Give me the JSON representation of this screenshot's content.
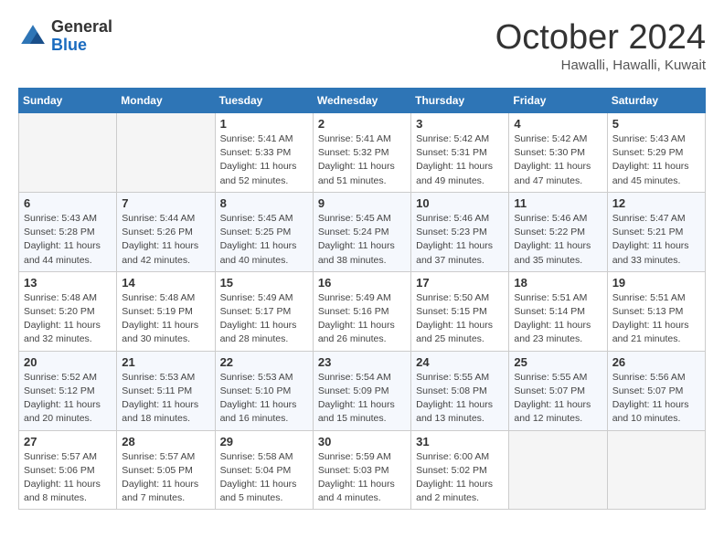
{
  "header": {
    "logo": {
      "general": "General",
      "blue": "Blue"
    },
    "title": "October 2024",
    "location": "Hawalli, Hawalli, Kuwait"
  },
  "weekdays": [
    "Sunday",
    "Monday",
    "Tuesday",
    "Wednesday",
    "Thursday",
    "Friday",
    "Saturday"
  ],
  "weeks": [
    [
      {
        "day": "",
        "empty": true
      },
      {
        "day": "",
        "empty": true
      },
      {
        "day": "1",
        "sunrise": "5:41 AM",
        "sunset": "5:33 PM",
        "daylight": "11 hours and 52 minutes."
      },
      {
        "day": "2",
        "sunrise": "5:41 AM",
        "sunset": "5:32 PM",
        "daylight": "11 hours and 51 minutes."
      },
      {
        "day": "3",
        "sunrise": "5:42 AM",
        "sunset": "5:31 PM",
        "daylight": "11 hours and 49 minutes."
      },
      {
        "day": "4",
        "sunrise": "5:42 AM",
        "sunset": "5:30 PM",
        "daylight": "11 hours and 47 minutes."
      },
      {
        "day": "5",
        "sunrise": "5:43 AM",
        "sunset": "5:29 PM",
        "daylight": "11 hours and 45 minutes."
      }
    ],
    [
      {
        "day": "6",
        "sunrise": "5:43 AM",
        "sunset": "5:28 PM",
        "daylight": "11 hours and 44 minutes."
      },
      {
        "day": "7",
        "sunrise": "5:44 AM",
        "sunset": "5:26 PM",
        "daylight": "11 hours and 42 minutes."
      },
      {
        "day": "8",
        "sunrise": "5:45 AM",
        "sunset": "5:25 PM",
        "daylight": "11 hours and 40 minutes."
      },
      {
        "day": "9",
        "sunrise": "5:45 AM",
        "sunset": "5:24 PM",
        "daylight": "11 hours and 38 minutes."
      },
      {
        "day": "10",
        "sunrise": "5:46 AM",
        "sunset": "5:23 PM",
        "daylight": "11 hours and 37 minutes."
      },
      {
        "day": "11",
        "sunrise": "5:46 AM",
        "sunset": "5:22 PM",
        "daylight": "11 hours and 35 minutes."
      },
      {
        "day": "12",
        "sunrise": "5:47 AM",
        "sunset": "5:21 PM",
        "daylight": "11 hours and 33 minutes."
      }
    ],
    [
      {
        "day": "13",
        "sunrise": "5:48 AM",
        "sunset": "5:20 PM",
        "daylight": "11 hours and 32 minutes."
      },
      {
        "day": "14",
        "sunrise": "5:48 AM",
        "sunset": "5:19 PM",
        "daylight": "11 hours and 30 minutes."
      },
      {
        "day": "15",
        "sunrise": "5:49 AM",
        "sunset": "5:17 PM",
        "daylight": "11 hours and 28 minutes."
      },
      {
        "day": "16",
        "sunrise": "5:49 AM",
        "sunset": "5:16 PM",
        "daylight": "11 hours and 26 minutes."
      },
      {
        "day": "17",
        "sunrise": "5:50 AM",
        "sunset": "5:15 PM",
        "daylight": "11 hours and 25 minutes."
      },
      {
        "day": "18",
        "sunrise": "5:51 AM",
        "sunset": "5:14 PM",
        "daylight": "11 hours and 23 minutes."
      },
      {
        "day": "19",
        "sunrise": "5:51 AM",
        "sunset": "5:13 PM",
        "daylight": "11 hours and 21 minutes."
      }
    ],
    [
      {
        "day": "20",
        "sunrise": "5:52 AM",
        "sunset": "5:12 PM",
        "daylight": "11 hours and 20 minutes."
      },
      {
        "day": "21",
        "sunrise": "5:53 AM",
        "sunset": "5:11 PM",
        "daylight": "11 hours and 18 minutes."
      },
      {
        "day": "22",
        "sunrise": "5:53 AM",
        "sunset": "5:10 PM",
        "daylight": "11 hours and 16 minutes."
      },
      {
        "day": "23",
        "sunrise": "5:54 AM",
        "sunset": "5:09 PM",
        "daylight": "11 hours and 15 minutes."
      },
      {
        "day": "24",
        "sunrise": "5:55 AM",
        "sunset": "5:08 PM",
        "daylight": "11 hours and 13 minutes."
      },
      {
        "day": "25",
        "sunrise": "5:55 AM",
        "sunset": "5:07 PM",
        "daylight": "11 hours and 12 minutes."
      },
      {
        "day": "26",
        "sunrise": "5:56 AM",
        "sunset": "5:07 PM",
        "daylight": "11 hours and 10 minutes."
      }
    ],
    [
      {
        "day": "27",
        "sunrise": "5:57 AM",
        "sunset": "5:06 PM",
        "daylight": "11 hours and 8 minutes."
      },
      {
        "day": "28",
        "sunrise": "5:57 AM",
        "sunset": "5:05 PM",
        "daylight": "11 hours and 7 minutes."
      },
      {
        "day": "29",
        "sunrise": "5:58 AM",
        "sunset": "5:04 PM",
        "daylight": "11 hours and 5 minutes."
      },
      {
        "day": "30",
        "sunrise": "5:59 AM",
        "sunset": "5:03 PM",
        "daylight": "11 hours and 4 minutes."
      },
      {
        "day": "31",
        "sunrise": "6:00 AM",
        "sunset": "5:02 PM",
        "daylight": "11 hours and 2 minutes."
      },
      {
        "day": "",
        "empty": true
      },
      {
        "day": "",
        "empty": true
      }
    ]
  ],
  "labels": {
    "sunrise": "Sunrise: ",
    "sunset": "Sunset: ",
    "daylight": "Daylight: "
  }
}
